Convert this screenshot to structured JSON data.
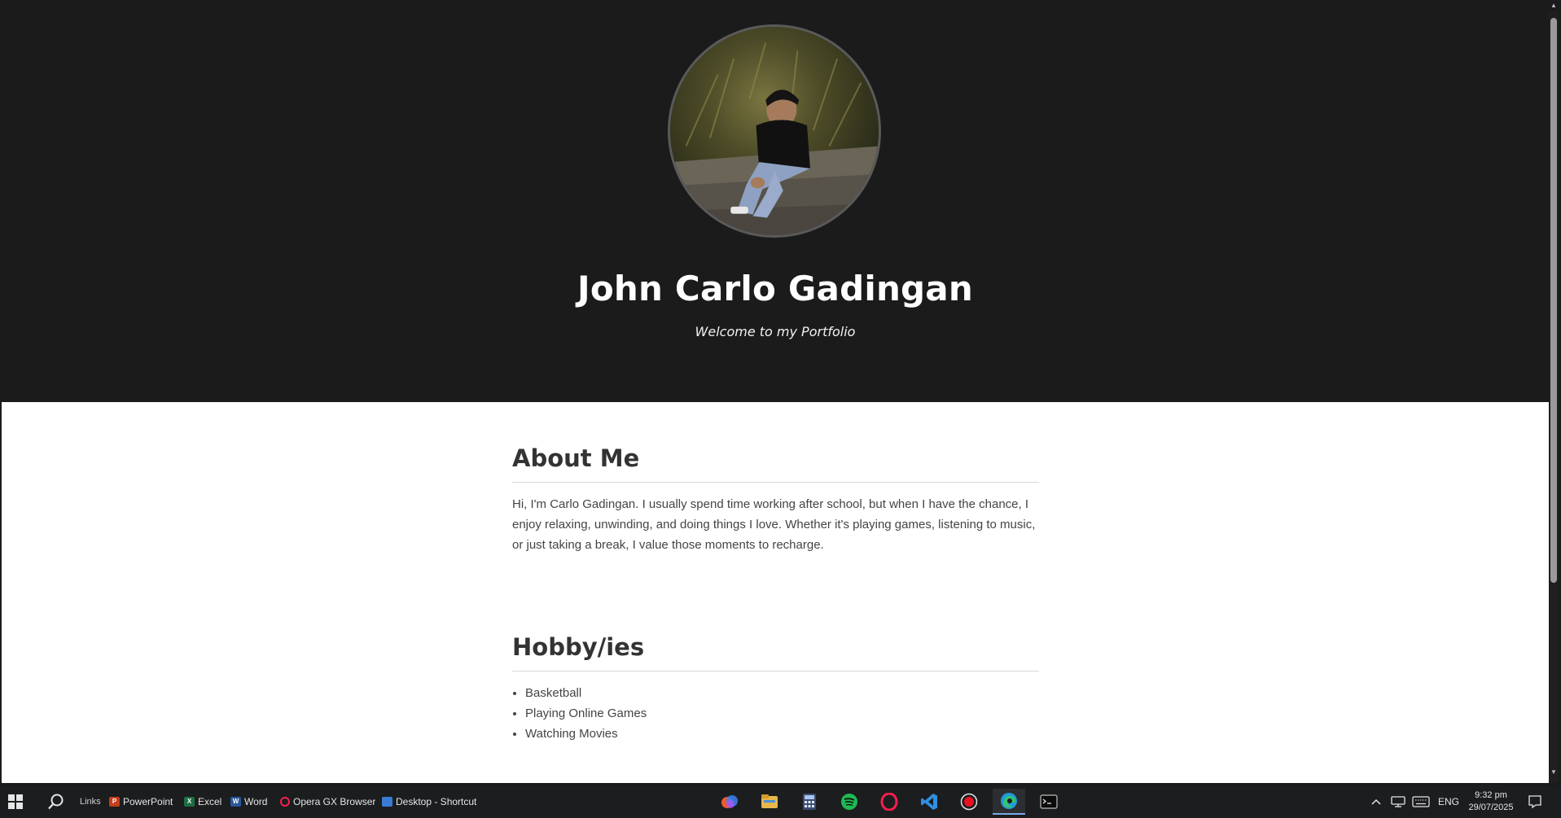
{
  "profile": {
    "name": "John Carlo Gadingan",
    "tagline": "Welcome to my Portfolio"
  },
  "about": {
    "heading": "About Me",
    "text": "Hi, I'm Carlo Gadingan. I usually spend time working after school, but when I have the chance, I enjoy relaxing, unwinding, and doing things I love. Whether it's playing games, listening to music, or just taking a break, I value those moments to recharge."
  },
  "hobbies": {
    "heading": "Hobby/ies",
    "items": [
      "Basketball",
      "Playing Online Games",
      "Watching Movies"
    ]
  },
  "taskbar": {
    "links_label": "Links",
    "quick_links": [
      {
        "label": "PowerPoint",
        "icon": "powerpoint-icon",
        "color": "#c43e1c",
        "mini": "P"
      },
      {
        "label": "Excel",
        "icon": "excel-icon",
        "color": "#1d6f42",
        "mini": "X"
      },
      {
        "label": "Word",
        "icon": "word-icon",
        "color": "#2b579a",
        "mini": "W"
      },
      {
        "label": "Opera GX Browser",
        "icon": "opera-gx-icon",
        "color": "#fa1e4e",
        "mini": ""
      },
      {
        "label": "Desktop - Shortcut",
        "icon": "desktop-icon",
        "color": "#3a7bd5",
        "mini": ""
      }
    ],
    "apps": [
      "copilot-icon",
      "file-explorer-icon",
      "calculator-icon",
      "spotify-icon",
      "opera-gx-icon",
      "vscode-icon",
      "recorder-icon",
      "edge-icon",
      "terminal-icon"
    ],
    "tray": {
      "language": "ENG",
      "time": "9:32 pm",
      "date": "29/07/2025"
    }
  }
}
